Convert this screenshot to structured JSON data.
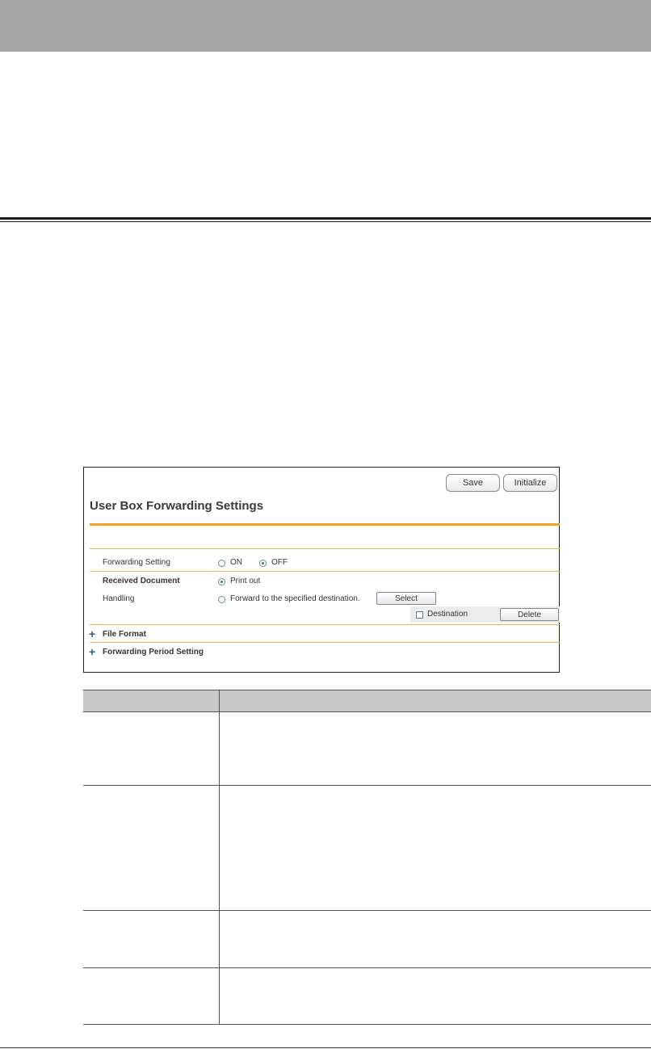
{
  "panel": {
    "buttons": {
      "save": "Save",
      "initialize": "Initialize"
    },
    "title": "User Box Forwarding Settings",
    "forwarding_setting": {
      "label": "Forwarding Setting",
      "option_on": "ON",
      "option_off": "OFF",
      "selected": "OFF"
    },
    "received_document": {
      "label": "Received Document",
      "option_print": "Print out"
    },
    "handling": {
      "label": "Handling",
      "option_forward": "Forward to the specified destination.",
      "select_button": "Select"
    },
    "destination": {
      "label": "Destination",
      "delete_button": "Delete"
    },
    "sections": {
      "file_format": "File Format",
      "forwarding_period": "Forwarding Period Setting"
    }
  },
  "colors": {
    "accent": "#f0a020",
    "header_band": "#a6a6a6",
    "table_header": "#c8c8c8"
  },
  "icons": {
    "expand": "plus-icon"
  }
}
